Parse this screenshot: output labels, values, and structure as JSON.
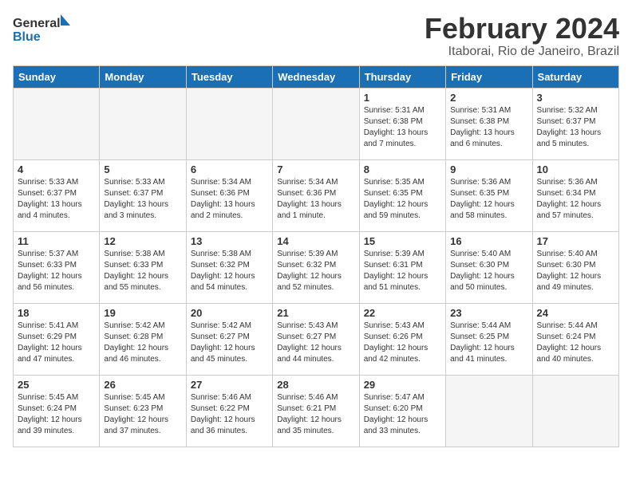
{
  "logo": {
    "line1": "General",
    "line2": "Blue"
  },
  "title": "February 2024",
  "subtitle": "Itaborai, Rio de Janeiro, Brazil",
  "days_of_week": [
    "Sunday",
    "Monday",
    "Tuesday",
    "Wednesday",
    "Thursday",
    "Friday",
    "Saturday"
  ],
  "weeks": [
    [
      {
        "day": "",
        "info": "",
        "empty": true
      },
      {
        "day": "",
        "info": "",
        "empty": true
      },
      {
        "day": "",
        "info": "",
        "empty": true
      },
      {
        "day": "",
        "info": "",
        "empty": true
      },
      {
        "day": "1",
        "info": "Sunrise: 5:31 AM\nSunset: 6:38 PM\nDaylight: 13 hours\nand 7 minutes."
      },
      {
        "day": "2",
        "info": "Sunrise: 5:31 AM\nSunset: 6:38 PM\nDaylight: 13 hours\nand 6 minutes."
      },
      {
        "day": "3",
        "info": "Sunrise: 5:32 AM\nSunset: 6:37 PM\nDaylight: 13 hours\nand 5 minutes."
      }
    ],
    [
      {
        "day": "4",
        "info": "Sunrise: 5:33 AM\nSunset: 6:37 PM\nDaylight: 13 hours\nand 4 minutes."
      },
      {
        "day": "5",
        "info": "Sunrise: 5:33 AM\nSunset: 6:37 PM\nDaylight: 13 hours\nand 3 minutes."
      },
      {
        "day": "6",
        "info": "Sunrise: 5:34 AM\nSunset: 6:36 PM\nDaylight: 13 hours\nand 2 minutes."
      },
      {
        "day": "7",
        "info": "Sunrise: 5:34 AM\nSunset: 6:36 PM\nDaylight: 13 hours\nand 1 minute."
      },
      {
        "day": "8",
        "info": "Sunrise: 5:35 AM\nSunset: 6:35 PM\nDaylight: 12 hours\nand 59 minutes."
      },
      {
        "day": "9",
        "info": "Sunrise: 5:36 AM\nSunset: 6:35 PM\nDaylight: 12 hours\nand 58 minutes."
      },
      {
        "day": "10",
        "info": "Sunrise: 5:36 AM\nSunset: 6:34 PM\nDaylight: 12 hours\nand 57 minutes."
      }
    ],
    [
      {
        "day": "11",
        "info": "Sunrise: 5:37 AM\nSunset: 6:33 PM\nDaylight: 12 hours\nand 56 minutes."
      },
      {
        "day": "12",
        "info": "Sunrise: 5:38 AM\nSunset: 6:33 PM\nDaylight: 12 hours\nand 55 minutes."
      },
      {
        "day": "13",
        "info": "Sunrise: 5:38 AM\nSunset: 6:32 PM\nDaylight: 12 hours\nand 54 minutes."
      },
      {
        "day": "14",
        "info": "Sunrise: 5:39 AM\nSunset: 6:32 PM\nDaylight: 12 hours\nand 52 minutes."
      },
      {
        "day": "15",
        "info": "Sunrise: 5:39 AM\nSunset: 6:31 PM\nDaylight: 12 hours\nand 51 minutes."
      },
      {
        "day": "16",
        "info": "Sunrise: 5:40 AM\nSunset: 6:30 PM\nDaylight: 12 hours\nand 50 minutes."
      },
      {
        "day": "17",
        "info": "Sunrise: 5:40 AM\nSunset: 6:30 PM\nDaylight: 12 hours\nand 49 minutes."
      }
    ],
    [
      {
        "day": "18",
        "info": "Sunrise: 5:41 AM\nSunset: 6:29 PM\nDaylight: 12 hours\nand 47 minutes."
      },
      {
        "day": "19",
        "info": "Sunrise: 5:42 AM\nSunset: 6:28 PM\nDaylight: 12 hours\nand 46 minutes."
      },
      {
        "day": "20",
        "info": "Sunrise: 5:42 AM\nSunset: 6:27 PM\nDaylight: 12 hours\nand 45 minutes."
      },
      {
        "day": "21",
        "info": "Sunrise: 5:43 AM\nSunset: 6:27 PM\nDaylight: 12 hours\nand 44 minutes."
      },
      {
        "day": "22",
        "info": "Sunrise: 5:43 AM\nSunset: 6:26 PM\nDaylight: 12 hours\nand 42 minutes."
      },
      {
        "day": "23",
        "info": "Sunrise: 5:44 AM\nSunset: 6:25 PM\nDaylight: 12 hours\nand 41 minutes."
      },
      {
        "day": "24",
        "info": "Sunrise: 5:44 AM\nSunset: 6:24 PM\nDaylight: 12 hours\nand 40 minutes."
      }
    ],
    [
      {
        "day": "25",
        "info": "Sunrise: 5:45 AM\nSunset: 6:24 PM\nDaylight: 12 hours\nand 39 minutes."
      },
      {
        "day": "26",
        "info": "Sunrise: 5:45 AM\nSunset: 6:23 PM\nDaylight: 12 hours\nand 37 minutes."
      },
      {
        "day": "27",
        "info": "Sunrise: 5:46 AM\nSunset: 6:22 PM\nDaylight: 12 hours\nand 36 minutes."
      },
      {
        "day": "28",
        "info": "Sunrise: 5:46 AM\nSunset: 6:21 PM\nDaylight: 12 hours\nand 35 minutes."
      },
      {
        "day": "29",
        "info": "Sunrise: 5:47 AM\nSunset: 6:20 PM\nDaylight: 12 hours\nand 33 minutes."
      },
      {
        "day": "",
        "info": "",
        "empty": true
      },
      {
        "day": "",
        "info": "",
        "empty": true
      }
    ]
  ]
}
